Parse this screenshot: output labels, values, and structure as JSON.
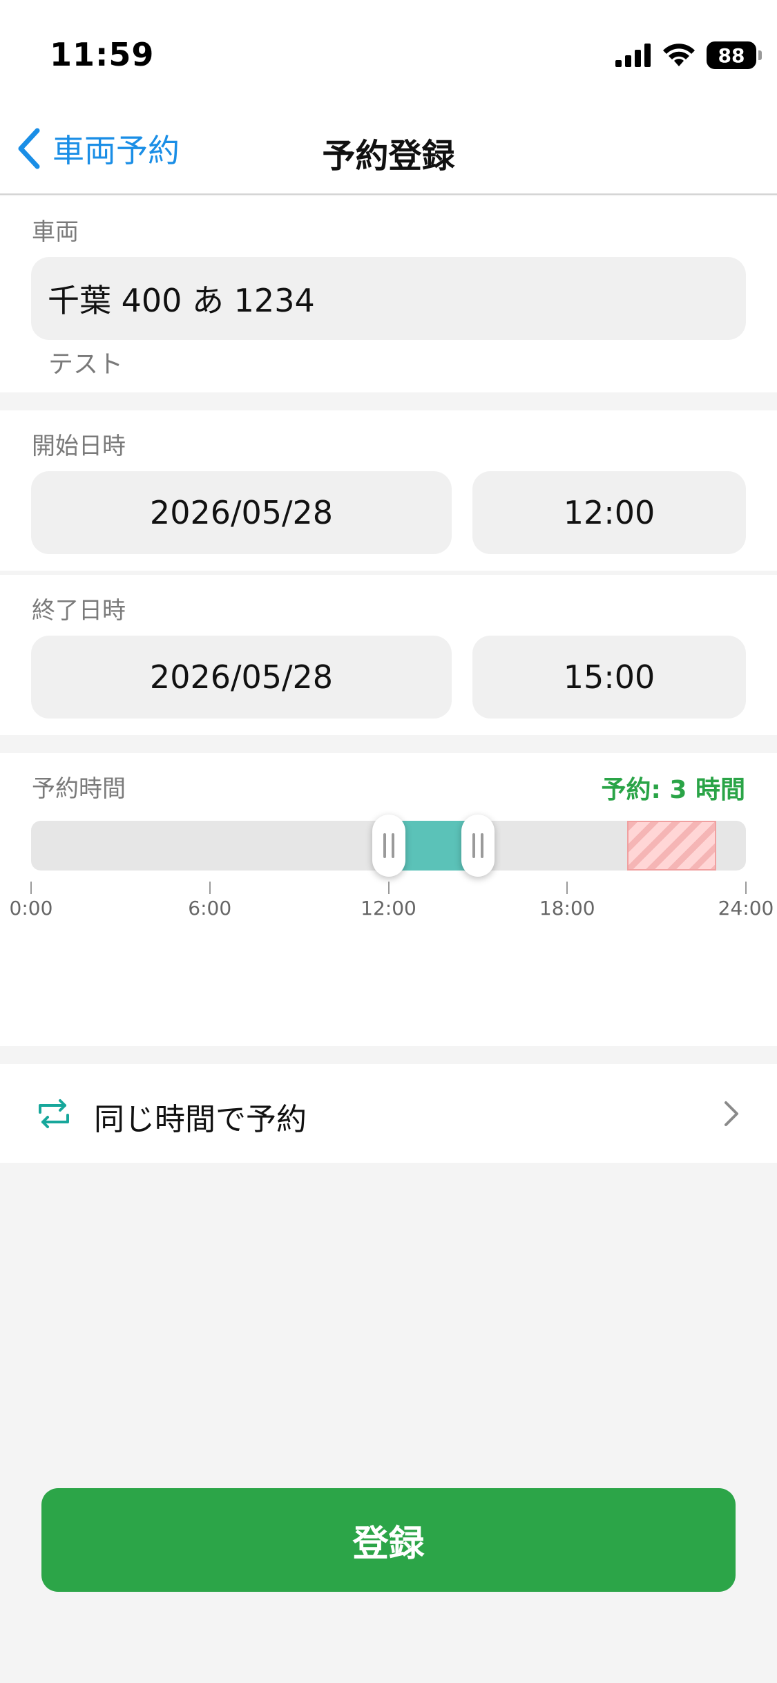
{
  "status_bar": {
    "time": "11:59",
    "battery": "88",
    "icons": [
      "cellular-signal-icon",
      "wifi-icon",
      "battery-icon"
    ]
  },
  "nav": {
    "back_label": "車両予約",
    "title": "予約登録",
    "back_icon": "chevron-left-icon",
    "accent_color": "#1a8ee6"
  },
  "vehicle": {
    "label": "車両",
    "value": "千葉 400 あ 1234",
    "sub_text": "テスト"
  },
  "start": {
    "label": "開始日時",
    "date": "2026/05/28",
    "time": "12:00"
  },
  "end": {
    "label": "終了日時",
    "date": "2026/05/28",
    "time": "15:00"
  },
  "reservation_time": {
    "label": "予約時間",
    "summary": "予約: 3 時間",
    "summary_color": "#2aa447",
    "range_start_hour": 12,
    "range_end_hour": 15,
    "blocked_start_hour": 20,
    "blocked_end_hour": 23,
    "axis_min_hour": 0,
    "axis_max_hour": 24,
    "ticks": [
      {
        "hour": 0,
        "label": "0:00"
      },
      {
        "hour": 6,
        "label": "6:00"
      },
      {
        "hour": 12,
        "label": "12:00"
      },
      {
        "hour": 18,
        "label": "18:00"
      },
      {
        "hour": 24,
        "label": "24:00"
      }
    ],
    "fill_color": "#5bc2b8"
  },
  "repeat": {
    "label": "同じ時間で予約",
    "icon": "repeat-icon",
    "chevron": "chevron-right-icon"
  },
  "register": {
    "label": "登録",
    "color": "#2ca548"
  }
}
